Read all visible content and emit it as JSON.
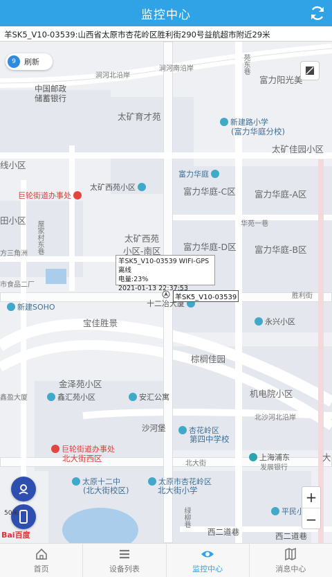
{
  "header": {
    "title": "监控中心"
  },
  "address": "羊SK5_V10-03539:山西省太原市杏花岭区胜利街290号益航超市附近29米",
  "refresh_chip": {
    "count": "9",
    "label": "刷新"
  },
  "infowindow": {
    "line1": "羊SK5_V10-03539 WIFI-GPS 离线",
    "line2": "电量:23%",
    "line3": "2021-01-13 22:37:53"
  },
  "plate": "羊SK5_V10-03539",
  "map_labels": {
    "road_fenhe1": "涧河北沿岸",
    "road_fenhe2": "涧河南沿岸",
    "post": "中国邮政",
    "post2": "储蓄银行",
    "fuli_yangguang": "富力阳光美",
    "taikuang": "太矿育才苑",
    "xinjian_school": "新建路小学",
    "xinjian_school2": "(富力华庭分校)",
    "yuanbei": "苑东巷",
    "taikuang_jia": "太矿佳园小区",
    "xian_area": "线小区",
    "fuli_tower": "富力华庭",
    "fuli_c": "富力华庭-C区",
    "fuli_a": "富力华庭-A区",
    "julun_office": "巨轮街道办事处",
    "taikuang_xi": "太矿西苑小区",
    "tianxiao": "田小区",
    "jiayuan": "屋家村东巷",
    "huayuan_one": "华苑一巷",
    "taikuang_nan": "太矿西苑",
    "taikuang_nan2": "小区-南区",
    "fuli_d": "富力华庭-D区",
    "fuli_b": "富力华庭-B区",
    "sanjiao": "方三角洲",
    "food": "市食品二厂",
    "new_soho": "新建SOHO",
    "tower12": "十二冶大厦",
    "shengli": "胜利街",
    "baoxin": "宝佳胜景",
    "yongxing": "永兴小区",
    "zonglv": "棕榈佳园",
    "jinjiang": "金泽苑小区",
    "xintower": "鑫盈大厦",
    "xinhui": "鑫汇苑小区",
    "anhui": "安汇公寓",
    "jidian": "机电院小区",
    "beiriver": "北沙河北沿岸",
    "shahe": "沙河堡",
    "xinghua_school": "杏花岭区",
    "xinghua_school2": "第四中学校",
    "julun_beida": "巨轮街道办事处",
    "beida_xi": "北大街西区",
    "beida": "北大街",
    "shanghai_bank": "上海浦东",
    "shanghai_bank2": "发展银行",
    "taiyuan12": "太原十二中",
    "taiyuan12b": "(北大街校区)",
    "xinghua_primary": "太原市杏花岭区",
    "xinghua_primary2": "北大街小学",
    "pingmin": "平民小",
    "lvyuan": "绿柳巷",
    "erdao": "西二道巷",
    "erdao2": "西二道巷",
    "dasha": "大"
  },
  "scale": "50米",
  "baidu": "Bai百度",
  "tabs": [
    {
      "label": "首页",
      "icon": "home-icon"
    },
    {
      "label": "设备列表",
      "icon": "list-icon"
    },
    {
      "label": "监控中心",
      "icon": "eye-icon"
    },
    {
      "label": "消息中心",
      "icon": "map-icon"
    }
  ],
  "colors": {
    "accent": "#2fa3e6",
    "side_button": "#2f4fb0"
  }
}
